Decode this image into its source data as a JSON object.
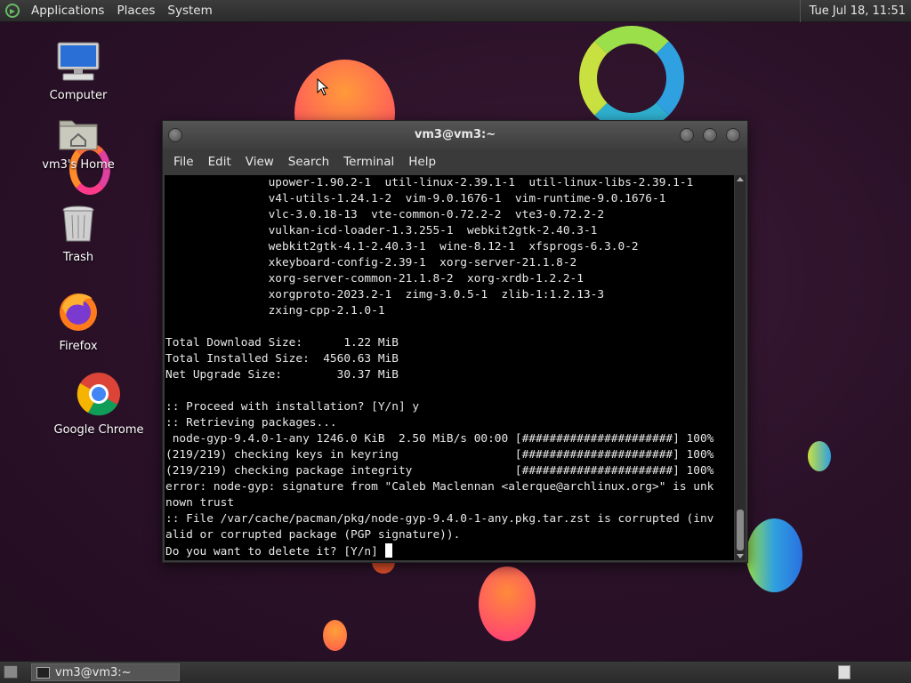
{
  "top_panel": {
    "menus": [
      "Applications",
      "Places",
      "System"
    ],
    "clock": "Tue Jul 18, 11:51"
  },
  "desktop": {
    "icons": [
      {
        "label": "Computer",
        "icon": "computer-icon"
      },
      {
        "label": "vm3's Home",
        "icon": "home-folder-icon"
      },
      {
        "label": "Trash",
        "icon": "trash-icon"
      },
      {
        "label": "Firefox",
        "icon": "firefox-icon"
      },
      {
        "label": "Google Chrome",
        "icon": "chrome-icon"
      }
    ]
  },
  "terminal": {
    "title": "vm3@vm3:~",
    "menus": [
      "File",
      "Edit",
      "View",
      "Search",
      "Terminal",
      "Help"
    ],
    "lines": [
      "               upower-1.90.2-1  util-linux-2.39.1-1  util-linux-libs-2.39.1-1",
      "               v4l-utils-1.24.1-2  vim-9.0.1676-1  vim-runtime-9.0.1676-1",
      "               vlc-3.0.18-13  vte-common-0.72.2-2  vte3-0.72.2-2",
      "               vulkan-icd-loader-1.3.255-1  webkit2gtk-2.40.3-1",
      "               webkit2gtk-4.1-2.40.3-1  wine-8.12-1  xfsprogs-6.3.0-2",
      "               xkeyboard-config-2.39-1  xorg-server-21.1.8-2",
      "               xorg-server-common-21.1.8-2  xorg-xrdb-1.2.2-1",
      "               xorgproto-2023.2-1  zimg-3.0.5-1  zlib-1:1.2.13-3",
      "               zxing-cpp-2.1.0-1",
      "",
      "Total Download Size:      1.22 MiB",
      "Total Installed Size:  4560.63 MiB",
      "Net Upgrade Size:        30.37 MiB",
      "",
      ":: Proceed with installation? [Y/n] y",
      ":: Retrieving packages...",
      " node-gyp-9.4.0-1-any 1246.0 KiB  2.50 MiB/s 00:00 [######################] 100%",
      "(219/219) checking keys in keyring                 [######################] 100%",
      "(219/219) checking package integrity               [######################] 100%",
      "error: node-gyp: signature from \"Caleb Maclennan <alerque@archlinux.org>\" is unk",
      "nown trust",
      ":: File /var/cache/pacman/pkg/node-gyp-9.4.0-1-any.pkg.tar.zst is corrupted (inv",
      "alid or corrupted package (PGP signature)).",
      "Do you want to delete it? [Y/n] "
    ]
  },
  "taskbar": {
    "window_button": "vm3@vm3:~"
  }
}
